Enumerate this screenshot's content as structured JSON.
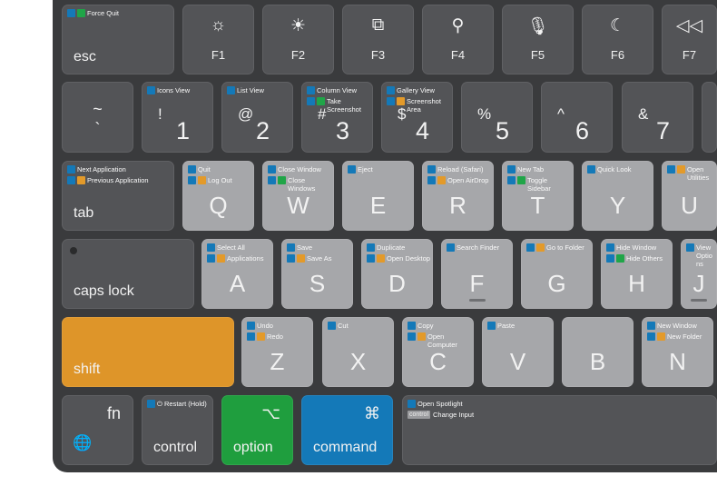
{
  "colors": {
    "cmd": "#1479b8",
    "shift": "#e39a2a",
    "option": "#20a548",
    "key_dark": "#535457",
    "key_light": "#a6a7aa",
    "shift_key": "#de9529",
    "option_key": "#1f9e3e",
    "command_key": "#1479b8"
  },
  "rows": [
    [
      {
        "id": "esc",
        "style": "dark",
        "label": "esc",
        "legends": [
          {
            "mods": [
              "cmd",
              "option"
            ],
            "text": "Force Quit"
          }
        ]
      },
      {
        "id": "f1",
        "style": "dark",
        "fn": "F1",
        "icon": "brightness-down-icon",
        "glyph": "☼"
      },
      {
        "id": "f2",
        "style": "dark",
        "fn": "F2",
        "icon": "brightness-up-icon",
        "glyph": "☀"
      },
      {
        "id": "f3",
        "style": "dark",
        "fn": "F3",
        "icon": "mission-control-icon",
        "glyph": "⧉"
      },
      {
        "id": "f4",
        "style": "dark",
        "fn": "F4",
        "icon": "search-icon",
        "glyph": "⚲"
      },
      {
        "id": "f5",
        "style": "dark",
        "fn": "F5",
        "icon": "microphone-icon",
        "glyph": "🎙"
      },
      {
        "id": "f6",
        "style": "dark",
        "fn": "F6",
        "icon": "moon-icon",
        "glyph": "☾"
      },
      {
        "id": "f7",
        "style": "dark",
        "fn": "F7",
        "icon": "rewind-icon",
        "glyph": "◁◁"
      }
    ],
    [
      {
        "id": "backtick",
        "style": "dark",
        "top": "~",
        "bottom": "`"
      },
      {
        "id": "1",
        "style": "dark",
        "sym": "!",
        "digit": "1",
        "legends": [
          {
            "mods": [
              "cmd"
            ],
            "text": "Icons View"
          }
        ]
      },
      {
        "id": "2",
        "style": "dark",
        "sym": "@",
        "digit": "2",
        "legends": [
          {
            "mods": [
              "cmd"
            ],
            "text": "List View"
          }
        ]
      },
      {
        "id": "3",
        "style": "dark",
        "sym": "#",
        "digit": "3",
        "legends": [
          {
            "mods": [
              "cmd"
            ],
            "text": "Column View"
          },
          {
            "mods": [
              "cmd",
              "option"
            ],
            "text": "Take Screenshot"
          }
        ]
      },
      {
        "id": "4",
        "style": "dark",
        "sym": "$",
        "digit": "4",
        "legends": [
          {
            "mods": [
              "cmd"
            ],
            "text": "Gallery View"
          },
          {
            "mods": [
              "cmd",
              "shift"
            ],
            "text": "Screenshot Area"
          }
        ]
      },
      {
        "id": "5",
        "style": "dark",
        "sym": "%",
        "digit": "5"
      },
      {
        "id": "6",
        "style": "dark",
        "sym": "^",
        "digit": "6"
      },
      {
        "id": "7",
        "style": "dark",
        "sym": "&",
        "digit": "7"
      },
      {
        "id": "8",
        "style": "dark",
        "sym": "",
        "digit": ""
      }
    ],
    [
      {
        "id": "tab",
        "style": "dark",
        "label": "tab",
        "legends": [
          {
            "mods": [
              "cmd"
            ],
            "text": "Next Application"
          },
          {
            "mods": [
              "cmd",
              "shift"
            ],
            "text": "Previous Application"
          }
        ]
      },
      {
        "id": "q",
        "style": "light",
        "letter": "Q",
        "legends": [
          {
            "mods": [
              "cmd"
            ],
            "text": "Quit"
          },
          {
            "mods": [
              "cmd",
              "shift"
            ],
            "text": "Log Out"
          }
        ]
      },
      {
        "id": "w",
        "style": "light",
        "letter": "W",
        "legends": [
          {
            "mods": [
              "cmd"
            ],
            "text": "Close Window"
          },
          {
            "mods": [
              "cmd",
              "option"
            ],
            "text": "Close Windows"
          }
        ]
      },
      {
        "id": "e",
        "style": "light",
        "letter": "E",
        "legends": [
          {
            "mods": [
              "cmd"
            ],
            "text": "Eject"
          }
        ]
      },
      {
        "id": "r",
        "style": "light",
        "letter": "R",
        "legends": [
          {
            "mods": [
              "cmd"
            ],
            "text": "Reload (Safari)"
          },
          {
            "mods": [
              "cmd",
              "shift"
            ],
            "text": "Open AirDrop"
          }
        ]
      },
      {
        "id": "t",
        "style": "light",
        "letter": "T",
        "legends": [
          {
            "mods": [
              "cmd"
            ],
            "text": "New Tab"
          },
          {
            "mods": [
              "cmd",
              "option"
            ],
            "text": "Toggle Sidebar"
          }
        ]
      },
      {
        "id": "y",
        "style": "light",
        "letter": "Y",
        "legends": [
          {
            "mods": [
              "cmd"
            ],
            "text": "Quick Look"
          }
        ]
      },
      {
        "id": "u",
        "style": "light",
        "letter": "U",
        "legends": [
          {
            "mods": [
              "cmd",
              "shift"
            ],
            "text": "Open Utilities"
          }
        ]
      }
    ],
    [
      {
        "id": "caps",
        "style": "dark",
        "label": "caps lock",
        "led": true
      },
      {
        "id": "a",
        "style": "light",
        "letter": "A",
        "legends": [
          {
            "mods": [
              "cmd"
            ],
            "text": "Select All"
          },
          {
            "mods": [
              "cmd",
              "shift"
            ],
            "text": "Applications"
          }
        ]
      },
      {
        "id": "s",
        "style": "light",
        "letter": "S",
        "legends": [
          {
            "mods": [
              "cmd"
            ],
            "text": "Save"
          },
          {
            "mods": [
              "cmd",
              "shift"
            ],
            "text": "Save As"
          }
        ]
      },
      {
        "id": "d",
        "style": "light",
        "letter": "D",
        "legends": [
          {
            "mods": [
              "cmd"
            ],
            "text": "Duplicate"
          },
          {
            "mods": [
              "cmd",
              "shift"
            ],
            "text": "Open Desktop"
          }
        ]
      },
      {
        "id": "f",
        "style": "light",
        "letter": "F",
        "bump": true,
        "legends": [
          {
            "mods": [
              "cmd"
            ],
            "text": "Search Finder"
          }
        ]
      },
      {
        "id": "g",
        "style": "light",
        "letter": "G",
        "legends": [
          {
            "mods": [
              "cmd",
              "shift"
            ],
            "text": "Go to Folder"
          }
        ]
      },
      {
        "id": "h",
        "style": "light",
        "letter": "H",
        "legends": [
          {
            "mods": [
              "cmd"
            ],
            "text": "Hide Window"
          },
          {
            "mods": [
              "cmd",
              "option"
            ],
            "text": "Hide Others"
          }
        ]
      },
      {
        "id": "j",
        "style": "light",
        "letter": "J",
        "bump": true,
        "legends": [
          {
            "mods": [
              "cmd"
            ],
            "text": "View Options"
          }
        ]
      }
    ],
    [
      {
        "id": "shift",
        "style": "orange",
        "label": "shift"
      },
      {
        "id": "z",
        "style": "light",
        "letter": "Z",
        "legends": [
          {
            "mods": [
              "cmd"
            ],
            "text": "Undo"
          },
          {
            "mods": [
              "cmd",
              "shift"
            ],
            "text": "Redo"
          }
        ]
      },
      {
        "id": "x",
        "style": "light",
        "letter": "X",
        "legends": [
          {
            "mods": [
              "cmd"
            ],
            "text": "Cut"
          }
        ]
      },
      {
        "id": "c",
        "style": "light",
        "letter": "C",
        "legends": [
          {
            "mods": [
              "cmd"
            ],
            "text": "Copy"
          },
          {
            "mods": [
              "cmd",
              "shift"
            ],
            "text": "Open Computer"
          }
        ]
      },
      {
        "id": "v",
        "style": "light",
        "letter": "V",
        "legends": [
          {
            "mods": [
              "cmd"
            ],
            "text": "Paste"
          }
        ]
      },
      {
        "id": "b",
        "style": "light",
        "letter": "B"
      },
      {
        "id": "n",
        "style": "light",
        "letter": "N",
        "legends": [
          {
            "mods": [
              "cmd"
            ],
            "text": "New Window"
          },
          {
            "mods": [
              "cmd",
              "shift"
            ],
            "text": "New Folder"
          }
        ]
      }
    ],
    [
      {
        "id": "fn",
        "style": "dark",
        "topr": "fn",
        "globe": "🌐"
      },
      {
        "id": "control",
        "style": "dark",
        "label": "control",
        "legends": [
          {
            "mods": [
              "cmd"
            ],
            "text": "⏻ Restart (Hold)"
          }
        ]
      },
      {
        "id": "option",
        "style": "green",
        "label": "option",
        "topr": "⌥"
      },
      {
        "id": "command",
        "style": "blue",
        "label": "command",
        "topr": "⌘"
      },
      {
        "id": "space",
        "style": "dark",
        "legends": [
          {
            "mods": [
              "cmd"
            ],
            "text": "Open Spotlight"
          },
          {
            "pill": "control",
            "text": "Change Input"
          }
        ]
      }
    ]
  ]
}
